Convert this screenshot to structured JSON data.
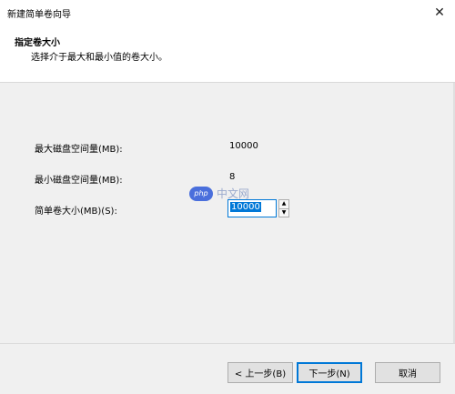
{
  "window": {
    "title": "新建简单卷向导",
    "close_icon": "close-icon"
  },
  "header": {
    "title": "指定卷大小",
    "subtitle": "选择介于最大和最小值的卷大小。"
  },
  "fields": [
    {
      "label": "最大磁盘空间量(MB):",
      "value": "10000"
    },
    {
      "label": "最小磁盘空间量(MB):",
      "value": "8"
    },
    {
      "label": "简单卷大小(MB)(S):",
      "value": "10000"
    }
  ],
  "spinner": {
    "up_icon": "▲",
    "down_icon": "▼"
  },
  "watermark": {
    "badge": "php",
    "text": "中文网"
  },
  "buttons": {
    "back": "< 上一步(B)",
    "next": "下一步(N)",
    "cancel": "取消"
  }
}
